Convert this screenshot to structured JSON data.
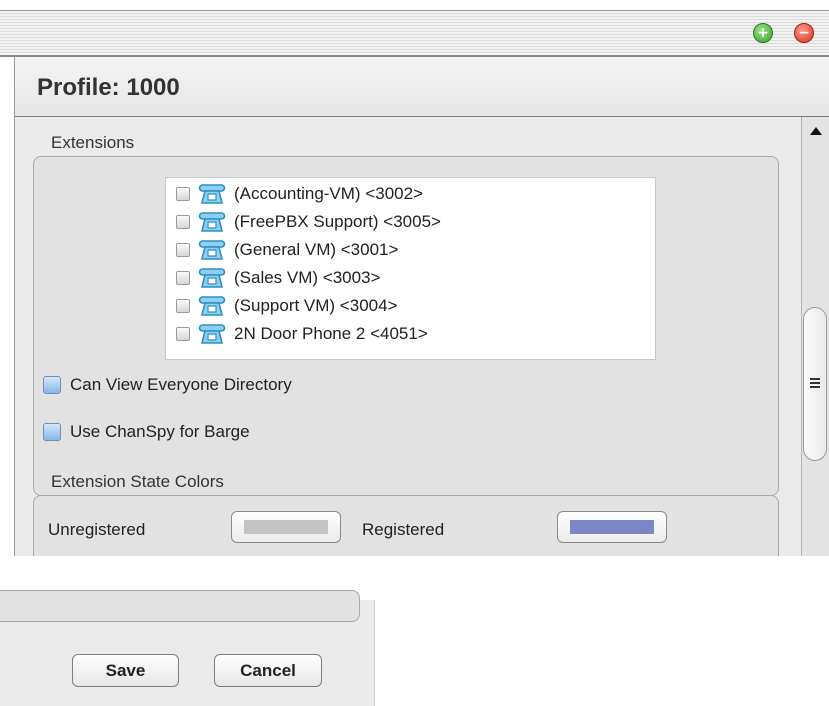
{
  "window": {
    "add_icon": "plus-circle-icon",
    "remove_icon": "minus-circle-icon",
    "add_glyph": "+",
    "remove_glyph": "−"
  },
  "profile": {
    "title": "Profile: 1000"
  },
  "extensions_section": {
    "label": "Extensions",
    "items": [
      {
        "label": "(Accounting-VM) <3002>",
        "icon": "phone-icon",
        "checked": false
      },
      {
        "label": "(FreePBX Support) <3005>",
        "icon": "phone-icon",
        "checked": false
      },
      {
        "label": "(General VM) <3001>",
        "icon": "phone-icon",
        "checked": false
      },
      {
        "label": "(Sales VM) <3003>",
        "icon": "phone-icon",
        "checked": false
      },
      {
        "label": "(Support VM) <3004>",
        "icon": "phone-icon",
        "checked": false
      },
      {
        "label": "2N Door Phone 2 <4051>",
        "icon": "phone-icon",
        "checked": false
      }
    ],
    "can_view_everyone": {
      "label": "Can View Everyone Directory",
      "checked": false
    },
    "use_chanspy": {
      "label": "Use ChanSpy for Barge",
      "checked": false
    }
  },
  "state_colors_section": {
    "label": "Extension State Colors",
    "unregistered": {
      "label": "Unregistered",
      "color": "#c4c4c4"
    },
    "registered": {
      "label": "Registered",
      "color": "#7b86c4"
    }
  },
  "actions": {
    "save_label": "Save",
    "cancel_label": "Cancel"
  },
  "colors": {
    "phone_icon": "#2e8fc4",
    "checkbox_accent": "#88b6e6"
  }
}
